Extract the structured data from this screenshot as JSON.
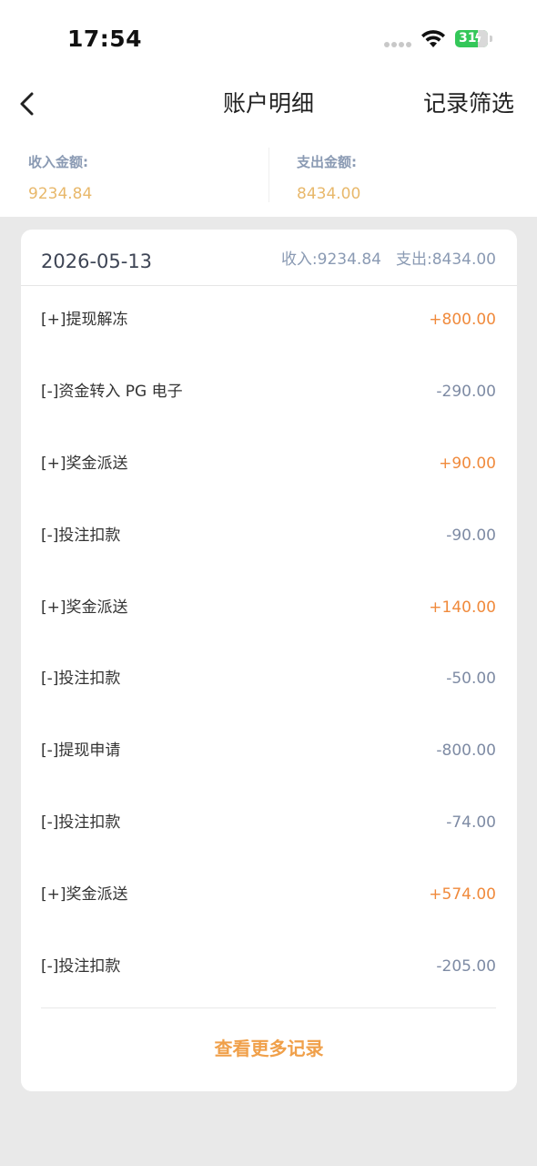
{
  "status_bar": {
    "time": "17:54",
    "battery": "31"
  },
  "nav": {
    "title": "账户明细",
    "filter_label": "记录筛选"
  },
  "summary": {
    "income_label": "收入金额:",
    "income_value": "9234.84",
    "expense_label": "支出金额:",
    "expense_value": "8434.00"
  },
  "card": {
    "date": "2026-05-13",
    "income_total": "收入:9234.84",
    "expense_total": "支出:8434.00",
    "rows": [
      {
        "label": "[+]提现解冻",
        "amount": "+800.00"
      },
      {
        "label": "[-]资金转入 PG 电子",
        "amount": "-290.00"
      },
      {
        "label": "[+]奖金派送",
        "amount": "+90.00"
      },
      {
        "label": "[-]投注扣款",
        "amount": "-90.00"
      },
      {
        "label": "[+]奖金派送",
        "amount": "+140.00"
      },
      {
        "label": "[-]投注扣款",
        "amount": "-50.00"
      },
      {
        "label": "[-]提现申请",
        "amount": "-800.00"
      },
      {
        "label": "[-]投注扣款",
        "amount": "-74.00"
      },
      {
        "label": "[+]奖金派送",
        "amount": "+574.00"
      },
      {
        "label": "[-]投注扣款",
        "amount": "-205.00"
      }
    ],
    "more_label": "查看更多记录"
  },
  "colors": {
    "positive": "#f08a3c",
    "negative": "#7e8ba4",
    "summary_value": "#e8b86b",
    "more_link": "#f0a04a"
  }
}
